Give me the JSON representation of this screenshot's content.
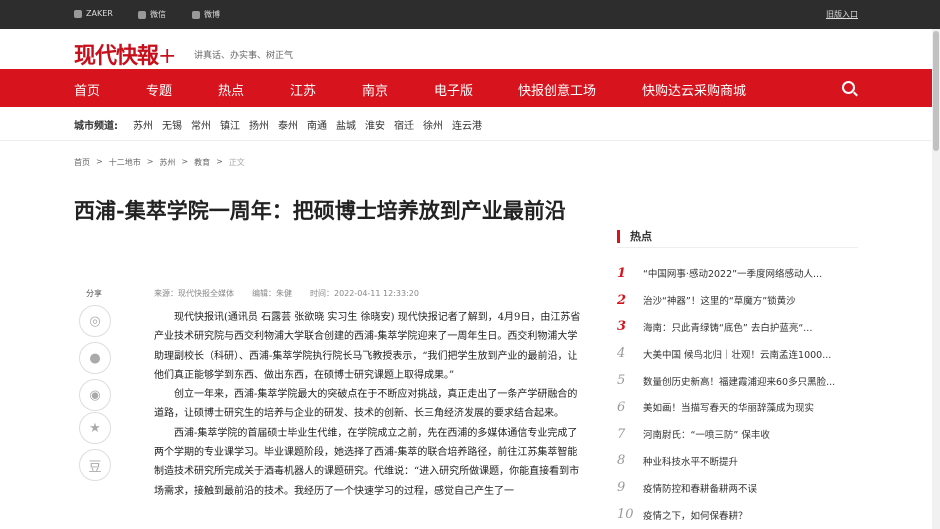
{
  "topbar": {
    "zaker": "ZAKER",
    "wechat": "微信",
    "weibo": "微博",
    "old": "旧版入口"
  },
  "logo": {
    "name": "现代快報",
    "plus": "+",
    "slogan": "讲真话、办实事、树正气"
  },
  "nav": [
    "首页",
    "专题",
    "热点",
    "江苏",
    "南京",
    "电子版",
    "快报创意工场",
    "快购达云采购商城"
  ],
  "city": {
    "label": "城市频道:",
    "items": [
      "苏州",
      "无锡",
      "常州",
      "镇江",
      "扬州",
      "泰州",
      "南通",
      "盐城",
      "淮安",
      "宿迁",
      "徐州",
      "连云港"
    ]
  },
  "breadcrumb": [
    "首页",
    ">",
    "十二地市",
    ">",
    "苏州",
    ">",
    "教育",
    ">",
    "正文"
  ],
  "article": {
    "title": "西浦-集萃学院一周年：把硕博士培养放到产业最前沿",
    "source": "来源：现代快报全媒体",
    "editor": "编辑：朱健",
    "time": "时间：2022-04-11 12:33:20",
    "paragraphs": [
      "现代快报讯(通讯员 石露芸 张欲晓 实习生 徐晓安) 现代快报记者了解到，4月9日，由江苏省产业技术研究院与西交利物浦大学联合创建的西浦-集萃学院迎来了一周年生日。西交利物浦大学助理副校长（科研）、西浦-集萃学院执行院长马飞教授表示，“我们把学生放到产业的最前沿，让他们真正能够学到东西、做出东西，在硕博士研究课题上取得成果。”",
      "创立一年来，西浦-集萃学院最大的突破点在于不断应对挑战，真正走出了一条产学研融合的道路，让硕博士研究生的培养与企业的研发、技术的创新、长三角经济发展的要求结合起来。",
      "西浦-集萃学院的首届硕士毕业生代维，在学院成立之前，先在西浦的多媒体通信专业完成了两个学期的专业课学习。毕业课题阶段，她选择了西浦-集萃的联合培养路径，前往江苏集萃智能制造技术研究所完成关于酒毒机器人的课题研究。代维说：“进入研究所做课题，你能直接看到市场需求，接触到最前沿的技术。我经历了一个快速学习的过程，感觉自己产生了一"
    ]
  },
  "share": {
    "label": "分享"
  },
  "hot": {
    "title": "热点",
    "items": [
      "“中国网事·感动2022”一季度网络感动人...",
      "治沙“神器”！这里的“草魔方”锁黄沙",
      "海南：只此青绿铸“底色” 去白护蓝亮“...",
      "大美中国 候鸟北归｜壮观！云南孟连1000...",
      "数量创历史新高！福建霞浦迎来60多只黑脸...",
      "美如画！当描写春天的华丽辞藻成为现实",
      "河南尉氏：“一喷三防” 保丰收",
      "种业科技水平不断提升",
      "疫情防控和春耕备耕两不误",
      "疫情之下，如何保春耕？"
    ],
    "nums": [
      "1",
      "2",
      "3",
      "4",
      "5",
      "6",
      "7",
      "8",
      "9",
      "10"
    ]
  },
  "colors": {
    "brand": "#d7141e"
  }
}
